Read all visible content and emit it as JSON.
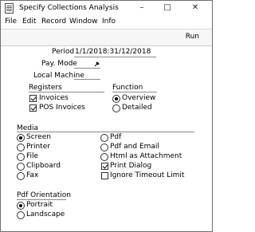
{
  "window": {
    "title": "Specify Collections Analysis"
  },
  "menu": [
    "File",
    "Edit",
    "Record",
    "Window",
    "Info"
  ],
  "toolbar": {
    "run_label": "Run"
  },
  "fields": {
    "period_label": "Period",
    "period_value": "1/1/2018:31/12/2018",
    "pay_mode_label": "Pay. Mode",
    "pay_mode_value": "",
    "local_machine_label": "Local Machine",
    "local_machine_value": ""
  },
  "registers": {
    "title": "Registers",
    "items": [
      {
        "label": "Invoices",
        "checked": true
      },
      {
        "label": "POS Invoices",
        "checked": true
      }
    ]
  },
  "function": {
    "title": "Function",
    "options": [
      {
        "label": "Overview",
        "selected": true
      },
      {
        "label": "Detailed",
        "selected": false
      }
    ]
  },
  "media": {
    "title": "Media",
    "left_options": [
      {
        "label": "Screen",
        "selected": true
      },
      {
        "label": "Printer",
        "selected": false
      },
      {
        "label": "File",
        "selected": false
      },
      {
        "label": "Clipboard",
        "selected": false
      },
      {
        "label": "Fax",
        "selected": false
      }
    ],
    "right_options": [
      {
        "label": "Pdf",
        "selected": false
      },
      {
        "label": "Pdf and Email",
        "selected": false
      },
      {
        "label": "Html as Attachment",
        "selected": false
      }
    ],
    "checkboxes": [
      {
        "label": "Print Dialog",
        "checked": true
      },
      {
        "label": "Ignore Timeout Limit",
        "checked": false
      }
    ]
  },
  "pdf_orientation": {
    "title": "Pdf Orientation",
    "options": [
      {
        "label": "Portrait",
        "selected": true
      },
      {
        "label": "Landscape",
        "selected": false
      }
    ]
  }
}
